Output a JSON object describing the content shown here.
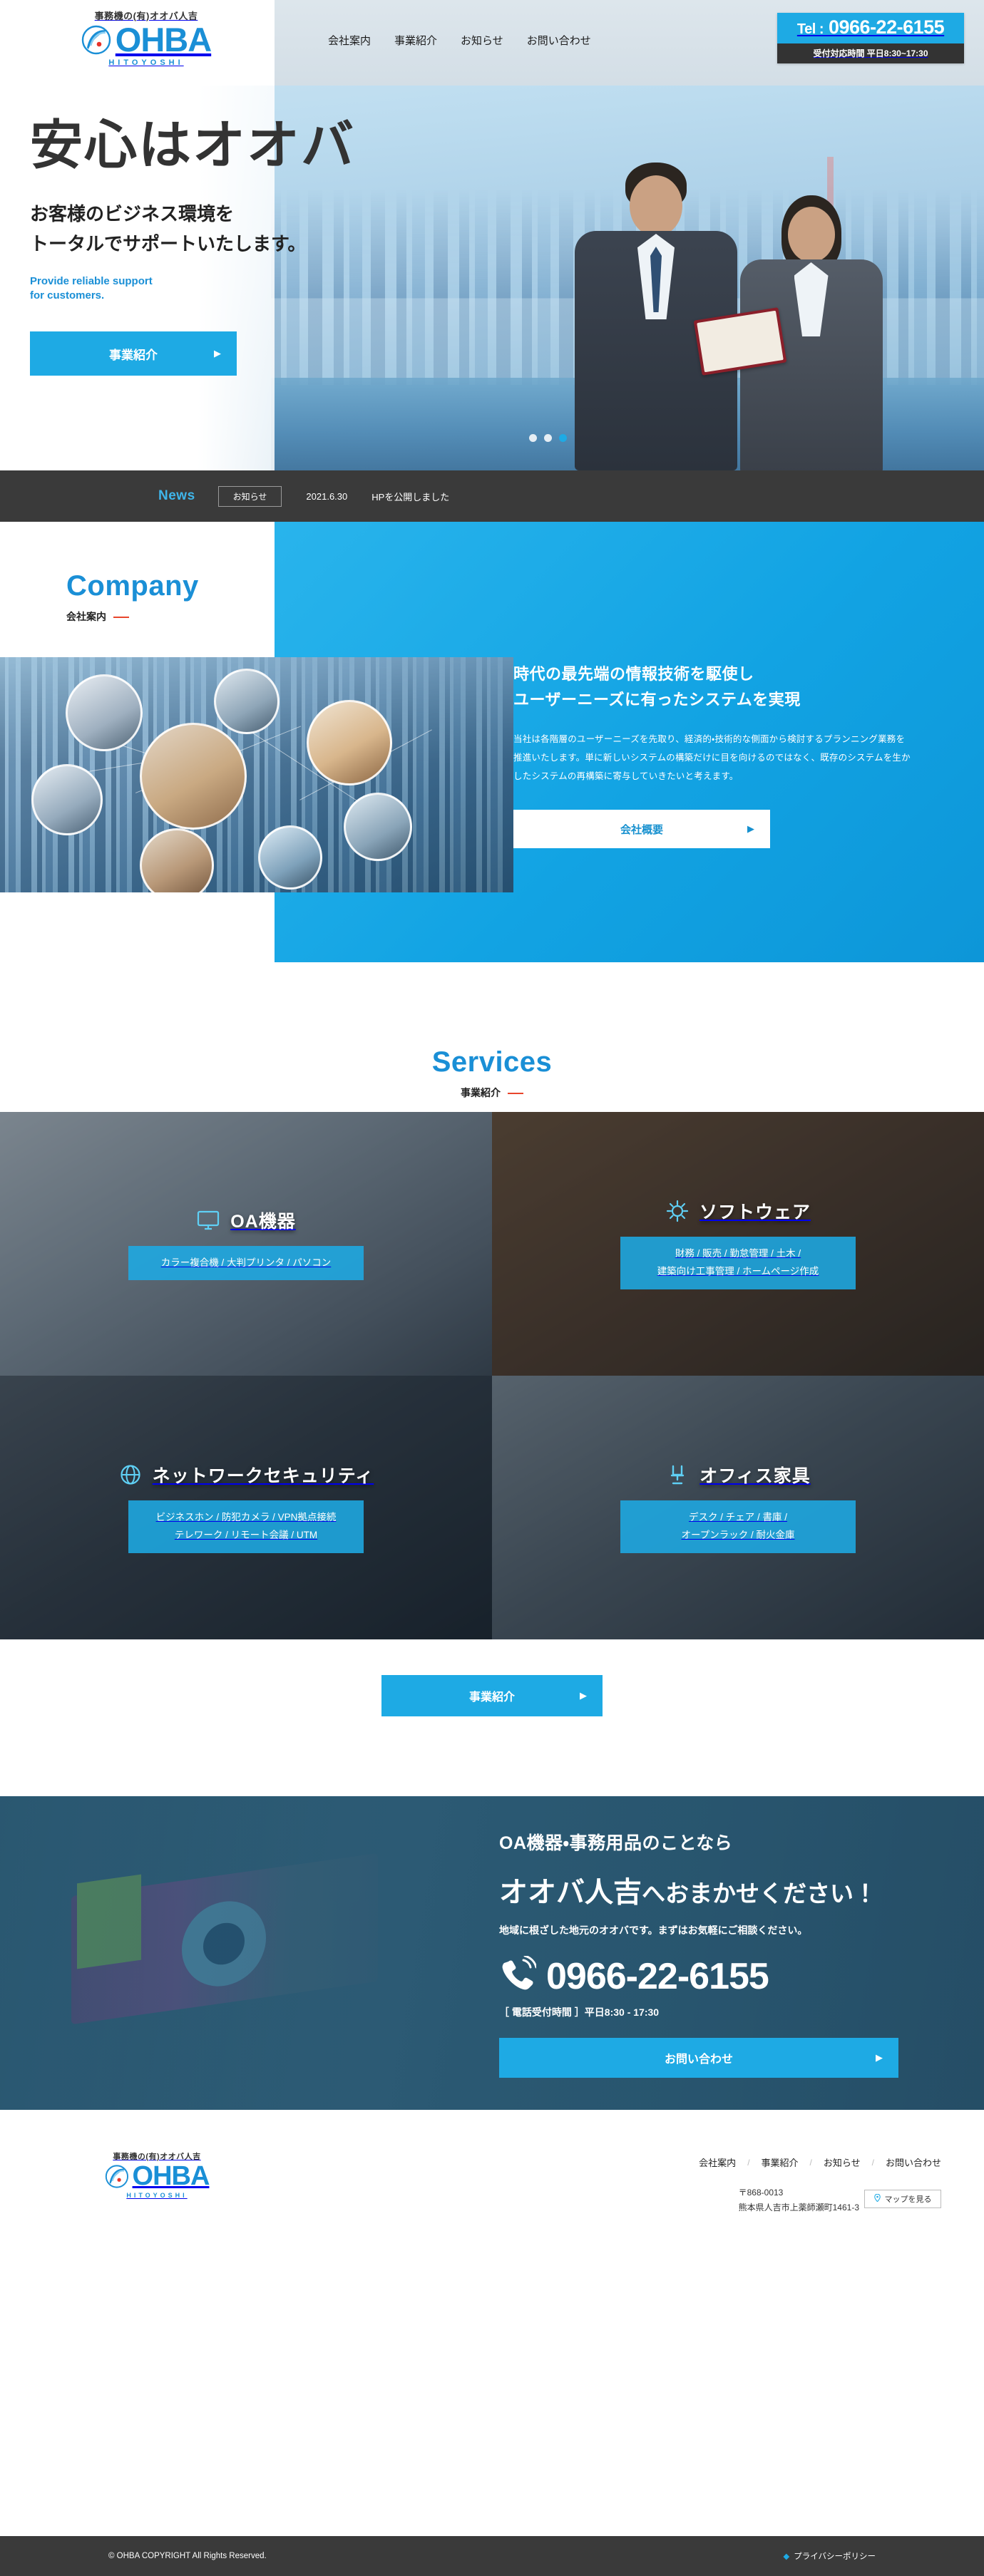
{
  "header": {
    "logo": {
      "tagline": "事務機の(有)オオバ人吉",
      "name": "OHBA",
      "sub": "HITOYOSHI",
      "mark_icon": "ohba-swoosh-logo-mark"
    },
    "nav": [
      {
        "label": "会社案内"
      },
      {
        "label": "事業紹介"
      },
      {
        "label": "お知らせ"
      },
      {
        "label": "お問い合わせ"
      }
    ],
    "tel": {
      "label": "Tel :",
      "number": "0966-22-6155",
      "hours": "受付対応時間 平日8:30~17:30"
    }
  },
  "hero": {
    "headline": "安心はオオバ",
    "sub_line1": "お客様のビジネス環境を",
    "sub_line2": "トータルでサポートいたします。",
    "en_line1": "Provide reliable support",
    "en_line2": "for customers.",
    "cta_label": "事業紹介",
    "cta_arrow": "▶",
    "slide_dots": 3,
    "active_dot": 3
  },
  "news": {
    "title": "News",
    "category": "お知らせ",
    "date": "2021.6.30",
    "text": "HPを公開しました"
  },
  "company": {
    "heading_en": "Company",
    "heading_ja": "会社案内",
    "title_line1": "時代の最先端の情報技術を駆使し",
    "title_line2": "ユーザーニーズに有ったシステムを実現",
    "body": "当社は各階層のユーザーニーズを先取り、経済的・技術的な側面から検討するプランニング業務を推進いたします。単に新しいシステムの構築だけに目を向けるのではなく、既存のシステムを生かしたシステムの再構築に寄与していきたいと考えます。",
    "cta_label": "会社概要",
    "cta_arrow": "▶"
  },
  "services": {
    "heading_en": "Services",
    "heading_ja": "事業紹介",
    "cards": [
      {
        "title": "OA機器",
        "icon": "monitor-icon",
        "tags": "カラー複合機 / 大判プリンタ / パソコン"
      },
      {
        "title": "ソフトウェア",
        "icon": "gear-code-icon",
        "tags_line1": "財務 / 販売 / 勤怠管理 / 土木 /",
        "tags_line2": "建築向け工事管理 / ホームページ作成"
      },
      {
        "title": "ネットワークセキュリティ",
        "icon": "network-shield-icon",
        "tags_line1": "ビジネスホン / 防犯カメラ / VPN拠点接続",
        "tags_line2": "テレワーク / リモート会議 / UTM"
      },
      {
        "title": "オフィス家具",
        "icon": "chair-icon",
        "tags_line1": "デスク / チェア / 書庫 /",
        "tags_line2": "オープンラック / 耐火金庫"
      }
    ],
    "cta_label": "事業紹介",
    "cta_arrow": "▶"
  },
  "cta": {
    "line1": "OA機器・事務用品のことなら",
    "line2_strong": "オオバ人吉",
    "line2_rest": "へおまかせください！",
    "note": "地域に根ざした地元のオオバです。まずはお気軽にご相談ください。",
    "phone_icon": "phone-ringing-icon",
    "phone": "0966-22-6155",
    "hours": "［ 電話受付時間 ］平日8:30 - 17:30",
    "button_label": "お問い合わせ",
    "button_arrow": "▶"
  },
  "footer": {
    "logo": {
      "tagline": "事務機の(有)オオバ人吉",
      "name": "OHBA",
      "sub": "HITOYOSHI",
      "mark_icon": "ohba-swoosh-logo-mark"
    },
    "nav": [
      {
        "label": "会社案内"
      },
      {
        "label": "事業紹介"
      },
      {
        "label": "お知らせ"
      },
      {
        "label": "お問い合わせ"
      }
    ],
    "sep": "/",
    "postal": "〒868-0013",
    "address": "熊本県人吉市上薬師瀬町1461-3",
    "map_label": "マップを見る",
    "map_icon": "map-pin-icon",
    "copyright": "© OHBA COPYRIGHT All Rights Reserved.",
    "privacy": "プライバシーポリシー",
    "privacy_bullet": "◆"
  },
  "colors": {
    "accent": "#1eaae4",
    "dark": "#3a3a3a",
    "logo_blue": "#1a8fd6",
    "red_bar": "#e8452c"
  }
}
